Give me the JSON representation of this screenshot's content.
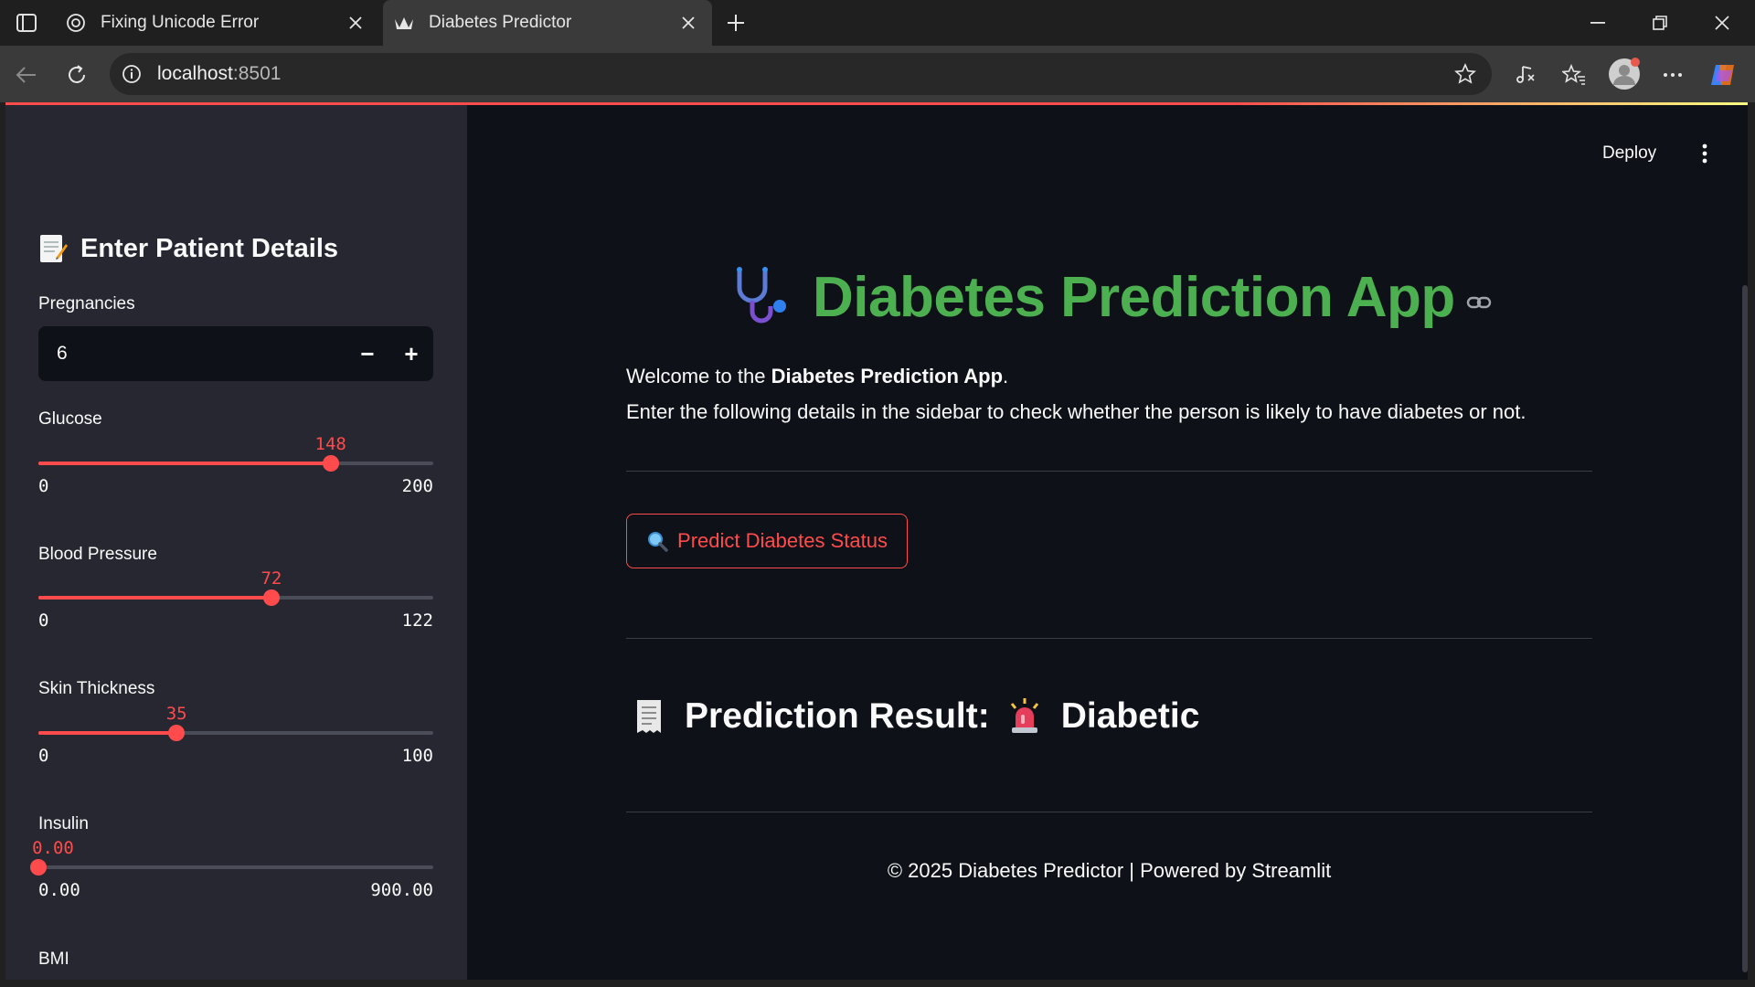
{
  "browser": {
    "tabs": [
      {
        "title": "Fixing Unicode Error",
        "icon": "openai-icon"
      },
      {
        "title": "Diabetes Predictor",
        "icon": "streamlit-icon"
      }
    ],
    "address": {
      "host": "localhost",
      "port": ":8501"
    }
  },
  "app": {
    "deploy_label": "Deploy",
    "title": "Diabetes Prediction App",
    "intro_prefix": "Welcome to the ",
    "intro_bold": "Diabetes Prediction App",
    "intro_suffix": ".",
    "intro_line2": "Enter the following details in the sidebar to check whether the person is likely to have diabetes or not.",
    "predict_button": "Predict Diabetes Status",
    "result_label": "Prediction Result:",
    "result_value": "Diabetic",
    "footer": "© 2025 Diabetes Predictor | Powered by Streamlit"
  },
  "sidebar": {
    "header": "Enter Patient Details",
    "pregnancies": {
      "label": "Pregnancies",
      "value": "6",
      "minus": "−",
      "plus": "+"
    },
    "sliders": [
      {
        "label": "Glucose",
        "value": "148",
        "min": "0",
        "max": "200",
        "value_num": 148,
        "min_num": 0,
        "max_num": 200
      },
      {
        "label": "Blood Pressure",
        "value": "72",
        "min": "0",
        "max": "122",
        "value_num": 72,
        "min_num": 0,
        "max_num": 122
      },
      {
        "label": "Skin Thickness",
        "value": "35",
        "min": "0",
        "max": "100",
        "value_num": 35,
        "min_num": 0,
        "max_num": 100
      },
      {
        "label": "Insulin",
        "value": "0.00",
        "min": "0.00",
        "max": "900.00",
        "value_num": 0,
        "min_num": 0,
        "max_num": 900
      }
    ],
    "bmi_label": "BMI"
  },
  "colors": {
    "accent": "#ff4b4b",
    "title": "#4caf50",
    "sidebar_bg": "#262730",
    "main_bg": "#0e1117"
  }
}
